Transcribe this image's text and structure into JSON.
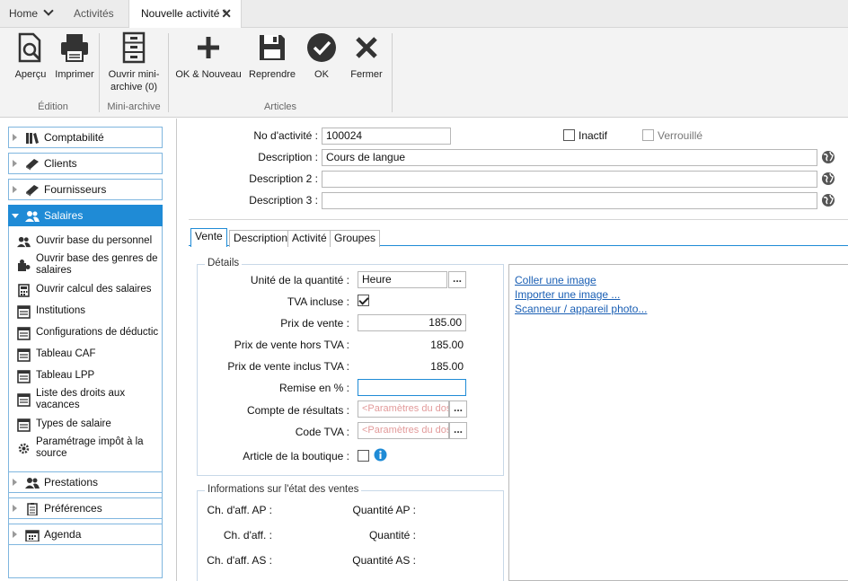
{
  "tabs": {
    "home": "Home",
    "activities": "Activités",
    "new_activity": "Nouvelle activité *",
    "close": "✕"
  },
  "ribbon": {
    "preview": "Aperçu",
    "print": "Imprimer",
    "edition_group": "Édition",
    "open_mini_archive": "Ouvrir mini-archive (0)",
    "mini_archive_group": "Mini-archive",
    "ok_new": "OK & Nouveau",
    "resume": "Reprendre",
    "ok": "OK",
    "close": "Fermer",
    "articles_group": "Articles"
  },
  "nav": {
    "comptabilite": "Comptabilité",
    "clients": "Clients",
    "fournisseurs": "Fournisseurs",
    "salaires": "Salaires",
    "sub": [
      "Ouvrir base du personnel",
      "Ouvrir base des genres de salaires",
      "Ouvrir calcul des salaires",
      "Institutions",
      "Configurations de déductic",
      "Tableau CAF",
      "Tableau LPP",
      "Liste des droits aux vacances",
      "Types de salaire",
      "Paramétrage impôt à la source"
    ],
    "prestations": "Prestations",
    "preferences": "Préférences",
    "agenda": "Agenda"
  },
  "header": {
    "no_label": "No d'activité :",
    "no_value": "100024",
    "inactive_label": "Inactif",
    "locked_label": "Verrouillé",
    "desc_label": "Description :",
    "desc_value": "Cours de langue",
    "desc2_label": "Description 2 :",
    "desc2_value": "",
    "desc3_label": "Description 3 :",
    "desc3_value": ""
  },
  "inner_tabs": [
    "Vente",
    "Description",
    "Activité",
    "Groupes"
  ],
  "details": {
    "title": "Détails",
    "unit_label": "Unité de la quantité :",
    "unit_value": "Heure",
    "vat_incl_label": "TVA incluse :",
    "price_label": "Prix de vente :",
    "price_value": "185.00",
    "price_excl_label": "Prix de vente hors TVA :",
    "price_excl_value": "185.00",
    "price_incl_label": "Prix de vente inclus TVA :",
    "price_incl_value": "185.00",
    "discount_label": "Remise en % :",
    "discount_value": "",
    "account_label": "Compte de résultats :",
    "account_placeholder": "<Paramètres du dos",
    "vat_code_label": "Code TVA :",
    "vat_code_placeholder": "<Paramètres du dos",
    "shop_label": "Article de la boutique :",
    "dots": "..."
  },
  "sales_info": {
    "title": "Informations sur l'état des ventes",
    "ch_ap": "Ch. d'aff. AP :",
    "qty_ap": "Quantité AP :",
    "ch": "Ch. d'aff. :",
    "qty": "Quantité :",
    "ch_as": "Ch. d'aff. AS :",
    "qty_as": "Quantité AS :"
  },
  "image_links": {
    "paste": "Coller une image",
    "import": "Importer une image ...",
    "scan": "Scanneur / appareil photo..."
  },
  "colors": {
    "accent": "#1f8bd6",
    "link": "#1a5fb4",
    "placeholder": "#e29a9a"
  }
}
